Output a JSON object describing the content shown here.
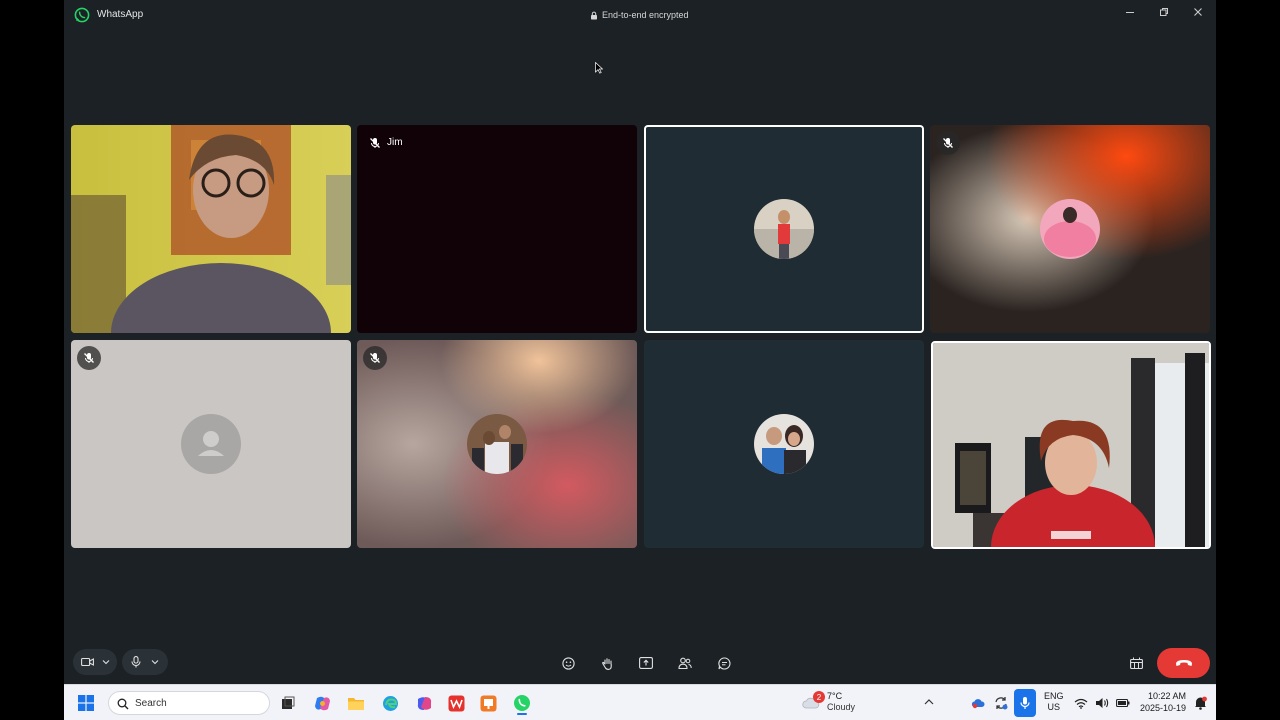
{
  "window": {
    "app_name": "WhatsApp",
    "encryption_label": "End-to-end encrypted"
  },
  "participants": [
    {
      "name": "",
      "muted": false,
      "kind": "video"
    },
    {
      "name": "Jim",
      "muted": true,
      "kind": "dark"
    },
    {
      "name": "",
      "muted": false,
      "kind": "avatar",
      "speaking": true
    },
    {
      "name": "",
      "muted": true,
      "kind": "blur-avatar"
    },
    {
      "name": "",
      "muted": true,
      "kind": "placeholder"
    },
    {
      "name": "",
      "muted": true,
      "kind": "blur-avatar"
    },
    {
      "name": "",
      "muted": false,
      "kind": "avatar"
    },
    {
      "name": "",
      "muted": false,
      "kind": "video",
      "self": true
    }
  ],
  "controls": {
    "left": [
      "camera-button",
      "camera-options",
      "mic-button",
      "mic-options"
    ],
    "center": [
      "reactions-button",
      "raise-hand-button",
      "share-screen-button",
      "add-participants-button",
      "chat-button"
    ],
    "right": [
      "layout-button",
      "end-call-button"
    ]
  },
  "taskbar": {
    "search_placeholder": "Search",
    "weather": {
      "badge": "2",
      "temp": "7°C",
      "condition": "Cloudy"
    },
    "language": {
      "line1": "ENG",
      "line2": "US"
    },
    "clock": {
      "time": "10:22 AM",
      "date": "2025-10-19"
    }
  },
  "colors": {
    "window_bg": "#1b2125",
    "tile_bg": "#1f2c33",
    "end_call": "#e53935",
    "whatsapp_green": "#25d366"
  }
}
